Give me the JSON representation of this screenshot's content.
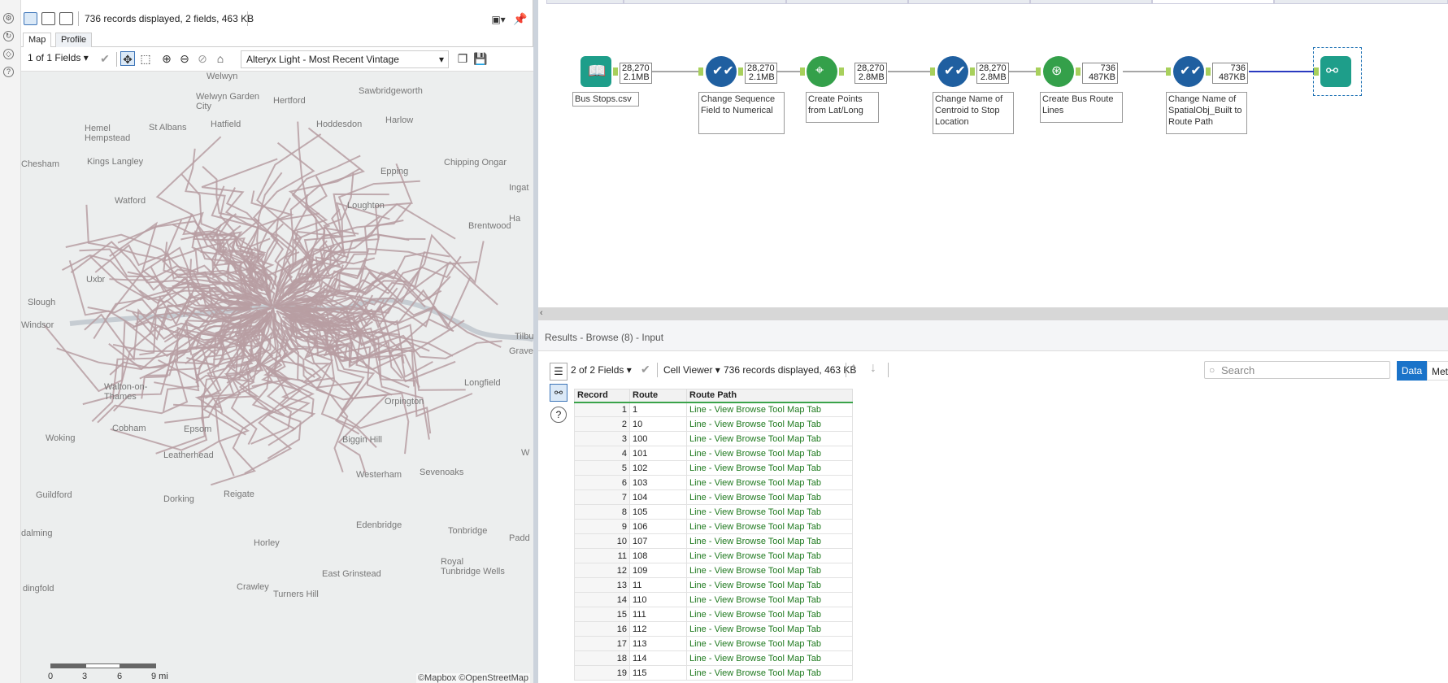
{
  "browse_panel": {
    "status": "736 records displayed, 2 fields, 463 KB",
    "tabs": [
      "Map",
      "Profile"
    ],
    "fields_select": "1 of 1 Fields",
    "base_map": "Alteryx Light - Most Recent Vintage",
    "places": [
      "Welwyn",
      "Sawbridgeworth",
      "Welwyn Garden City",
      "Hertford",
      "Hemel Hempstead",
      "St Albans",
      "Hatfield",
      "Hoddesdon",
      "Harlow",
      "Chesham",
      "Kings Langley",
      "Epping",
      "Chipping Ongar",
      "Watford",
      "Loughton",
      "Ingat",
      "Brentwood",
      "Uxbr",
      "Slough",
      "Windsor",
      "Tilbu",
      "Grave",
      "Walton-on-Thames",
      "Longfield",
      "Woking",
      "Cobham",
      "Leatherhead",
      "Sevenoaks",
      "Guildford",
      "Dorking",
      "Reigate",
      "Edenbridge",
      "Tonbridge",
      "Padd",
      "Horley",
      "Royal Tunbridge Wells",
      "Crawley",
      "Turners Hill",
      "East Grinstead",
      "dalming",
      "dingfold",
      "Westerham",
      "Biggin Hill",
      "Epsom",
      "Orpington",
      "Ha",
      "W"
    ],
    "scale_labels": [
      "0",
      "3",
      "6",
      "9 mi"
    ],
    "attribution": "©Mapbox ©OpenStreetMap"
  },
  "workflow": {
    "tools": [
      {
        "name": "Bus Stops.csv",
        "badge_count": "28,270",
        "badge_size": "2.1MB",
        "color": "#1e9e8a",
        "icon": "book-icon"
      },
      {
        "name": "Change Sequence Field to Numerical",
        "badge_count": "28,270",
        "badge_size": "2.1MB",
        "color": "#1f5fa0",
        "icon": "select-check-icon"
      },
      {
        "name": "Create Points from Lat/Long",
        "badge_count": "28,270",
        "badge_size": "2.8MB",
        "color": "#34a04a",
        "icon": "map-pin-icon"
      },
      {
        "name": "Change Name of Centroid to Stop Location",
        "badge_count": "28,270",
        "badge_size": "2.8MB",
        "color": "#1f5fa0",
        "icon": "select-check-icon"
      },
      {
        "name": "Create Bus Route Lines",
        "badge_count": "736",
        "badge_size": "487KB",
        "color": "#34a04a",
        "icon": "poly-build-icon"
      },
      {
        "name": "Change Name of SpatialObj_Built to Route Path",
        "badge_count": "736",
        "badge_size": "487KB",
        "color": "#1f5fa0",
        "icon": "select-check-icon"
      },
      {
        "name": "",
        "color": "#1e9e8a",
        "icon": "binoculars-icon"
      }
    ]
  },
  "results": {
    "title": "Results - Browse (8) - Input",
    "fields_select": "2 of 2 Fields",
    "cell_viewer": "Cell Viewer",
    "status": "736 records displayed, 463 KB",
    "search_placeholder": "Search",
    "data_btn": "Data",
    "metadata_btn": "Metadata",
    "columns": [
      "Record",
      "Route",
      "Route Path"
    ],
    "rows": [
      [
        "1",
        "1",
        "Line - View Browse Tool Map Tab"
      ],
      [
        "2",
        "10",
        "Line - View Browse Tool Map Tab"
      ],
      [
        "3",
        "100",
        "Line - View Browse Tool Map Tab"
      ],
      [
        "4",
        "101",
        "Line - View Browse Tool Map Tab"
      ],
      [
        "5",
        "102",
        "Line - View Browse Tool Map Tab"
      ],
      [
        "6",
        "103",
        "Line - View Browse Tool Map Tab"
      ],
      [
        "7",
        "104",
        "Line - View Browse Tool Map Tab"
      ],
      [
        "8",
        "105",
        "Line - View Browse Tool Map Tab"
      ],
      [
        "9",
        "106",
        "Line - View Browse Tool Map Tab"
      ],
      [
        "10",
        "107",
        "Line - View Browse Tool Map Tab"
      ],
      [
        "11",
        "108",
        "Line - View Browse Tool Map Tab"
      ],
      [
        "12",
        "109",
        "Line - View Browse Tool Map Tab"
      ],
      [
        "13",
        "11",
        "Line - View Browse Tool Map Tab"
      ],
      [
        "14",
        "110",
        "Line - View Browse Tool Map Tab"
      ],
      [
        "15",
        "111",
        "Line - View Browse Tool Map Tab"
      ],
      [
        "16",
        "112",
        "Line - View Browse Tool Map Tab"
      ],
      [
        "17",
        "113",
        "Line - View Browse Tool Map Tab"
      ],
      [
        "18",
        "114",
        "Line - View Browse Tool Map Tab"
      ],
      [
        "19",
        "115",
        "Line - View Browse Tool Map Tab"
      ]
    ]
  }
}
